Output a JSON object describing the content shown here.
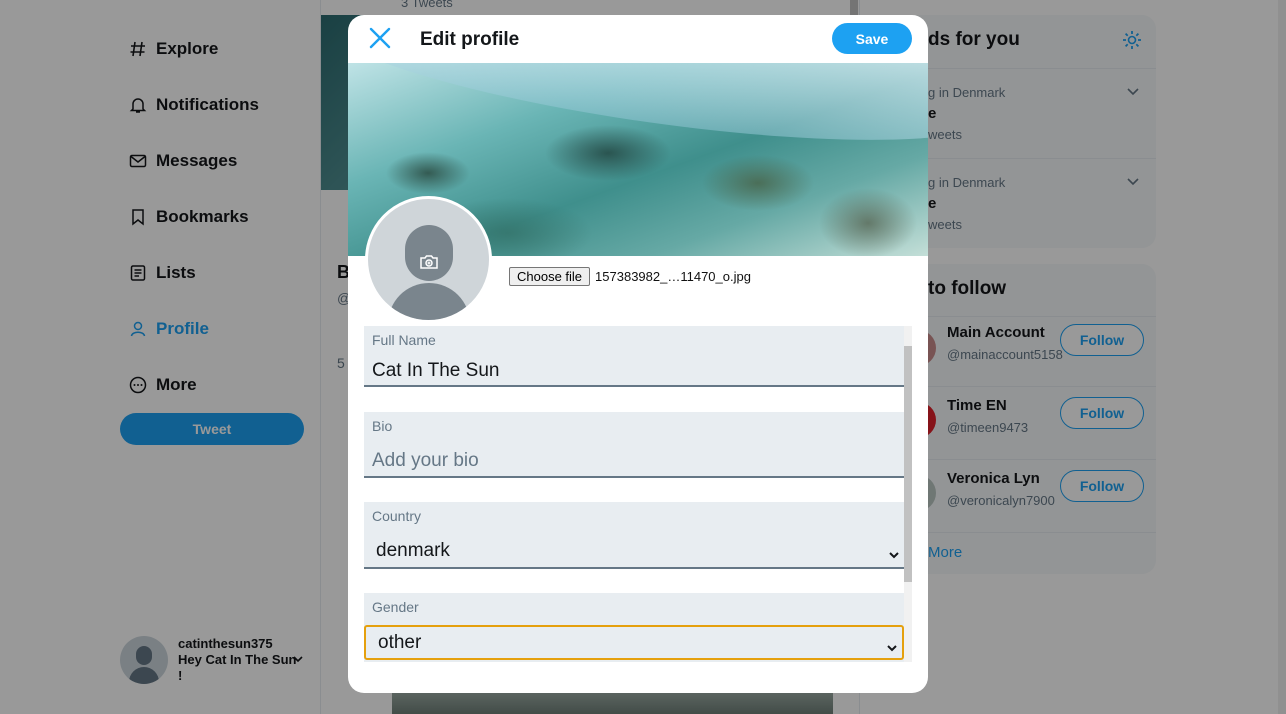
{
  "nav": {
    "items": [
      {
        "label": "Explore",
        "icon": "hashtag-icon"
      },
      {
        "label": "Notifications",
        "icon": "bell-icon"
      },
      {
        "label": "Messages",
        "icon": "envelope-icon"
      },
      {
        "label": "Bookmarks",
        "icon": "bookmark-icon"
      },
      {
        "label": "Lists",
        "icon": "list-icon"
      },
      {
        "label": "Profile",
        "icon": "person-icon",
        "active": true
      },
      {
        "label": "More",
        "icon": "more-icon"
      }
    ],
    "tweet_label": "Tweet"
  },
  "account": {
    "username": "catinthesun375",
    "display_name": "Hey Cat In The Sun !"
  },
  "center": {
    "tweet_count": "3 Tweets",
    "partial_letters": [
      "B",
      "@",
      "5"
    ]
  },
  "trends": {
    "title_partial": "ds for you",
    "items": [
      {
        "meta": "g in Denmark",
        "name": "e",
        "count": "weets"
      },
      {
        "meta": "g in Denmark",
        "name": "e",
        "count": "weets"
      }
    ]
  },
  "who_to_follow": {
    "title_partial": "to follow",
    "items": [
      {
        "name": "Main Account",
        "handle": "@mainaccount5158",
        "button": "Follow"
      },
      {
        "name": "Time EN",
        "handle": "@timeen9473",
        "button": "Follow"
      },
      {
        "name": "Veronica Lyn",
        "handle": "@veronicalyn7900",
        "button": "Follow"
      }
    ],
    "show_more": "More"
  },
  "modal": {
    "title": "Edit profile",
    "save_label": "Save",
    "file_button": "Choose file",
    "file_name": "157383982_…11470_o.jpg",
    "full_name": {
      "label": "Full Name",
      "value": "Cat In The Sun"
    },
    "bio": {
      "label": "Bio",
      "placeholder": "Add your bio"
    },
    "country": {
      "label": "Country",
      "value": "denmark"
    },
    "gender": {
      "label": "Gender",
      "value": "other"
    }
  },
  "colors": {
    "accent": "#1da1f2",
    "focus_ring": "#e5a00d",
    "field_bg": "#e8edf1"
  }
}
